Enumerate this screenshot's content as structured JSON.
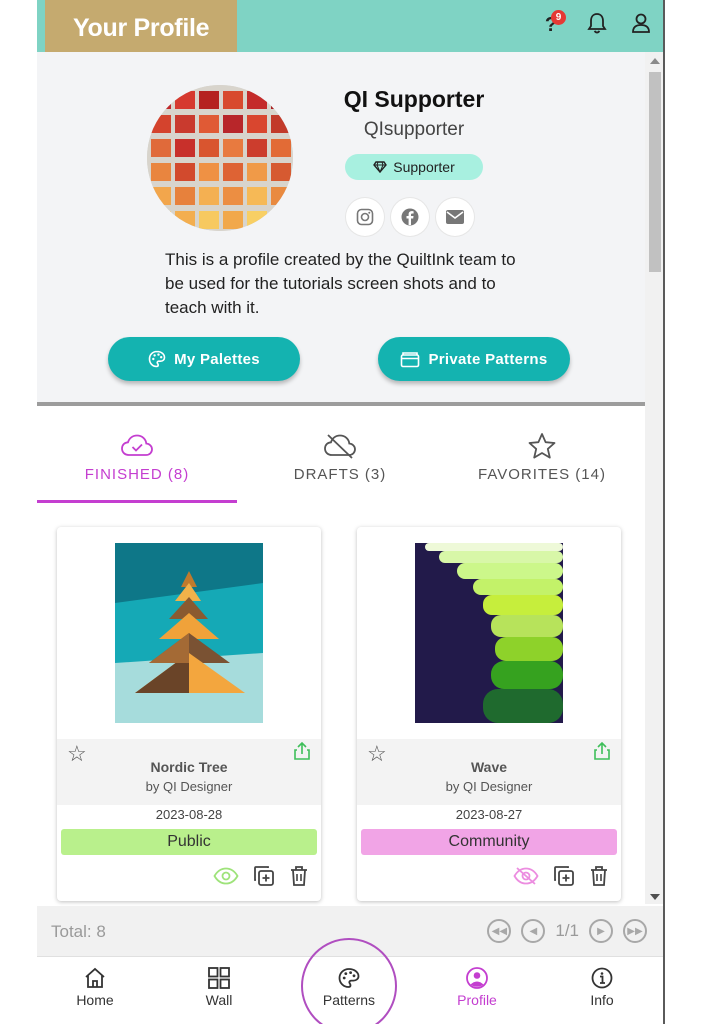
{
  "header": {
    "title": "Your Profile",
    "help_icon": "question-icon",
    "notification_count": "9",
    "bell_icon": "bell-icon",
    "user_icon": "user-icon"
  },
  "profile": {
    "name": "QI Supporter",
    "username": "QIsupporter",
    "badge": "Supporter",
    "badge_icon": "diamond-icon",
    "socials": [
      "instagram-icon",
      "facebook-icon",
      "email-icon"
    ],
    "bio": "This is a profile created by the QuiltInk team to be used for the tutorials screen shots and to teach with it.",
    "buttons": {
      "palettes": "My Palettes",
      "private_patterns": "Private Patterns"
    }
  },
  "tabs": [
    {
      "label": "FINISHED (8)",
      "icon": "cloud-check-icon",
      "active": true
    },
    {
      "label": "DRAFTS (3)",
      "icon": "cloud-off-icon",
      "active": false
    },
    {
      "label": "FAVORITES (14)",
      "icon": "star-icon",
      "active": false
    }
  ],
  "cards": [
    {
      "title": "Nordic Tree",
      "author": "by QI Designer",
      "date": "2023-08-28",
      "status": "Public",
      "visibility_icon": "eye-icon"
    },
    {
      "title": "Wave",
      "author": "by QI Designer",
      "date": "2023-08-27",
      "status": "Community",
      "visibility_icon": "eye-off-icon"
    }
  ],
  "pager": {
    "total": "Total: 8",
    "page": "1/1"
  },
  "nav": {
    "home": "Home",
    "wall": "Wall",
    "patterns": "Patterns",
    "profile": "Profile",
    "info": "Info"
  },
  "colors": {
    "topbar": "#7fd3c4",
    "accent_teal": "#14b3b0",
    "accent_purple": "#c43ed0",
    "public": "#b9f08c",
    "community": "#f1a4e6"
  }
}
